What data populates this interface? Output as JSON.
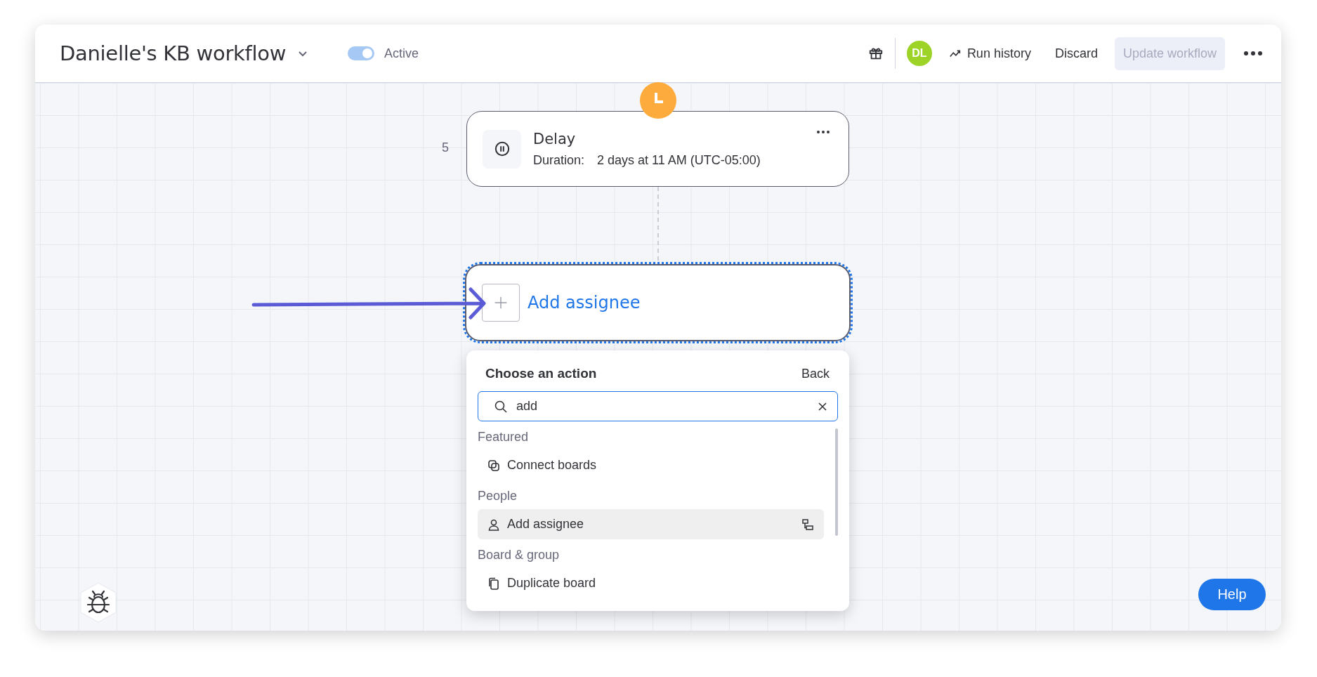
{
  "header": {
    "title": "Danielle's KB workflow",
    "toggle": {
      "on": true,
      "label": "Active"
    },
    "avatar": "DL",
    "run_history": "Run history",
    "discard": "Discard",
    "update": {
      "label": "Update workflow",
      "disabled": true
    }
  },
  "steps": [
    {
      "number": "5",
      "title": "Delay",
      "field_label": "Duration:",
      "field_value": "2 days at 11 AM (UTC-05:00)"
    }
  ],
  "new_step": {
    "label": "Add assignee",
    "selected": true
  },
  "action_menu": {
    "title": "Choose an action",
    "back": "Back",
    "search": {
      "value": "add"
    },
    "groups": [
      {
        "label": "Featured",
        "items": [
          {
            "label": "Connect boards",
            "kind": "connect",
            "selected": false
          }
        ]
      },
      {
        "label": "People",
        "items": [
          {
            "label": "Add assignee",
            "kind": "person",
            "selected": true
          }
        ]
      },
      {
        "label": "Board & group",
        "items": [
          {
            "label": "Duplicate board",
            "kind": "duplicate",
            "selected": false
          }
        ]
      }
    ]
  },
  "help": "Help"
}
